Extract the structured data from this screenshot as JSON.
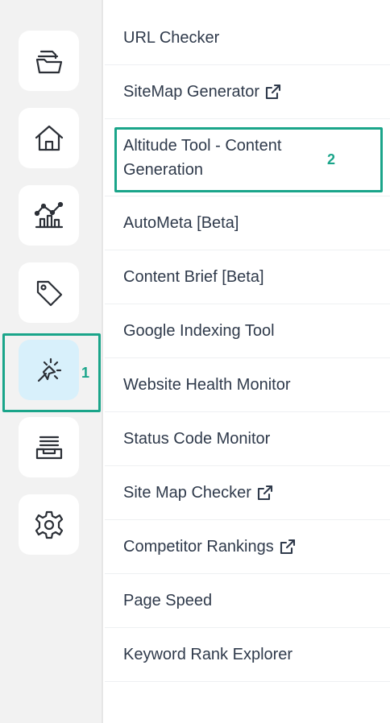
{
  "sidebar": {
    "items": [
      {
        "icon": "folder-icon"
      },
      {
        "icon": "home-icon"
      },
      {
        "icon": "analytics-chart-icon"
      },
      {
        "icon": "tag-icon"
      },
      {
        "icon": "magic-cursor-icon",
        "active": true
      },
      {
        "icon": "inbox-stack-icon"
      },
      {
        "icon": "gear-icon"
      }
    ],
    "active_color": "#d8f0fb"
  },
  "menu": {
    "items": [
      {
        "label": "URL Checker"
      },
      {
        "label": "SiteMap Generator",
        "external": true
      },
      {
        "label": "Altitude Tool - Content Generation"
      },
      {
        "label": "AutoMeta [Beta]"
      },
      {
        "label": "Content Brief [Beta]"
      },
      {
        "label": "Google Indexing Tool"
      },
      {
        "label": "Website Health Monitor"
      },
      {
        "label": "Status Code Monitor"
      },
      {
        "label": "Site Map Checker",
        "external": true
      },
      {
        "label": "Competitor Rankings",
        "external": true
      },
      {
        "label": "Page Speed"
      },
      {
        "label": "Keyword Rank Explorer"
      }
    ]
  },
  "annotations": {
    "one": "1",
    "two": "2",
    "color": "#1aa58a"
  }
}
